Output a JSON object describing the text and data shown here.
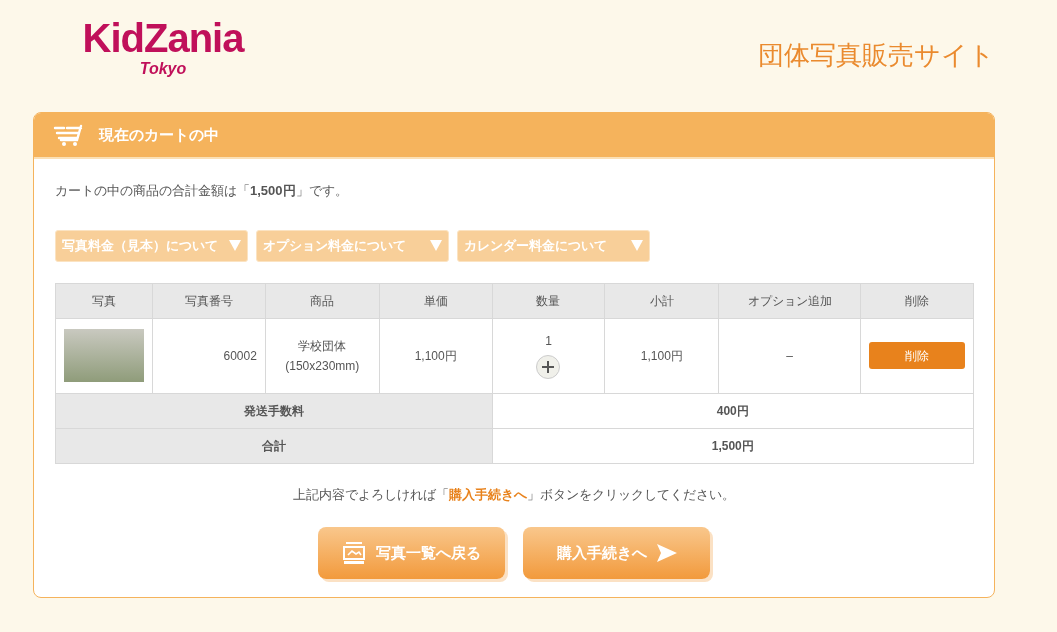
{
  "header": {
    "logo": "KidZania",
    "logo_sub": "Tokyo",
    "site_title": "団体写真販売サイト"
  },
  "cart": {
    "title": "現在のカートの中",
    "summary": "カートの中の商品の合計金額は「**1,500円**」です。",
    "dropdowns": [
      {
        "label": "写真料金（見本）について"
      },
      {
        "label": "オプション料金について"
      },
      {
        "label": "カレンダー料金について"
      }
    ],
    "table": {
      "columns": [
        "写真",
        "写真番号",
        "商品",
        "単価",
        "数量",
        "小計",
        "オプション追加",
        "削除"
      ],
      "rows": [
        {
          "photo_number": "60002",
          "product": "学校団体",
          "product_size": "(150x230mm)",
          "unit_price": "1,100円",
          "quantity": "1",
          "subtotal": "1,100円",
          "option": "–",
          "delete_label": "削除"
        }
      ],
      "fees": [
        {
          "label": "発送手数料",
          "value": "400円"
        },
        {
          "label": "合計",
          "value": "1,500円"
        }
      ]
    },
    "instruction": "上記内容でよろしければ「**購入手続きへ**」ボタンをクリックしてください。",
    "buttons": [
      {
        "kind": "back",
        "label": "写真一覧へ戻る"
      },
      {
        "kind": "next",
        "label": "購入手続きへ"
      }
    ]
  }
}
